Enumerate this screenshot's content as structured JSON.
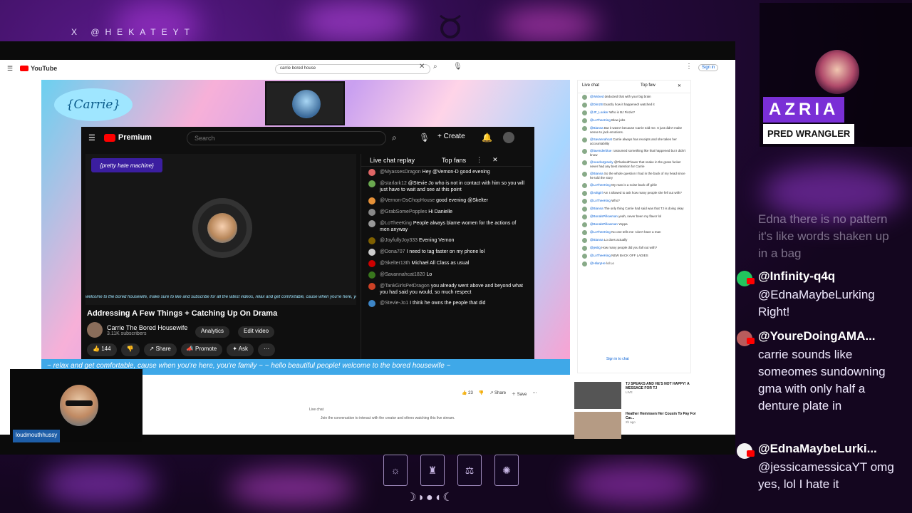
{
  "overlay": {
    "handle": "X @HEKATEYT",
    "streamer_name": "AZRIA",
    "streamer_role": "PRED WRANGLER",
    "webcam_label": "loudmouthhussy",
    "moon_phases": "☽◗●◖☾"
  },
  "browser": {
    "logo": "YouTube",
    "search_value": "carrie bored house",
    "signin": "Sign in"
  },
  "video": {
    "brand_logo": "{Carrie}",
    "banner_text": "{pretty hate machine}",
    "inner_logo": "Premium",
    "inner_search_placeholder": "Search",
    "inner_create": "+ Create",
    "ticker_inner": "welcome to the bored housewife, make sure to like and subscribe for all the latest videos, relax and get comfortable, cause when you're here, you're family",
    "title": "Addressing A Few Things + Catching Up On Drama",
    "channel": "Carrie The Bored Housewife",
    "subs": "3.11K subscribers",
    "analytics": "Analytics",
    "edit_video": "Edit video",
    "likes": "144",
    "share": "Share",
    "promote": "Promote",
    "ask": "Ask",
    "ticker": "~ relax and get comfortable, cause when you're here, you're family ~    ~ hello beautiful people! welcome to the bored housewife ~",
    "live_chat_header": "Live chat replay",
    "top_fans": "Top fans",
    "chat": [
      {
        "user": "@MyassesDragon",
        "text": "Hey @Vernon-D good evening",
        "color": "#e06666"
      },
      {
        "user": "@starlark12",
        "text": "@Stevie Jo who is not in contact with him so you will just have to wait and see at this point",
        "color": "#6aa84f"
      },
      {
        "user": "@Vernon-DsChopHouse",
        "text": "good evening @Skelter",
        "color": "#e69138"
      },
      {
        "user": "@GrabSomePopples",
        "text": "Hi Danielle",
        "color": "#888888"
      },
      {
        "user": "@LoTheeKing",
        "text": "People always blame women for the actions of men anyway",
        "color": "#999999"
      },
      {
        "user": "@JoyfullyJoy333",
        "text": "Evening Vernon",
        "color": "#7f6000"
      },
      {
        "user": "@Dona707",
        "text": "I need to tag faster on my phone lol",
        "color": "#cccccc"
      },
      {
        "user": "@Skelter13th",
        "text": "Michael All Class as usual",
        "color": "#cc0000"
      },
      {
        "user": "@Savannahcat1820",
        "text": "Lo",
        "color": "#38761d"
      },
      {
        "user": "@TankGirlsPetDragon",
        "text": "you already went above and beyond what you had said you would, so much respect",
        "color": "#cc4125"
      },
      {
        "user": "@Stevie-Jo1",
        "text": "I think he owns the people that did",
        "color": "#3d85c6"
      }
    ]
  },
  "page_chat": {
    "header": "Live chat",
    "top_few": "Top few",
    "signin": "Sign in to chat",
    "messages": [
      {
        "user": "@Wicked",
        "text": "deducted that with your big brain"
      },
      {
        "user": "@DimzB",
        "text": "Exactly how it happened! watched it"
      },
      {
        "user": "@JF_Looker",
        "text": "Who is BJ Finzie?"
      },
      {
        "user": "@LoTheeKing",
        "text": "Blow jobs"
      },
      {
        "user": "@Bianna",
        "text": "But it wasn't because Carrie told me. It just didn't make sense to jack emotions."
      },
      {
        "user": "@Savannahcat",
        "text": "Carrie always has receipts and she takes her accountability"
      },
      {
        "user": "@lavenderblue",
        "text": "I assumed something like that happened but I didn't know"
      },
      {
        "user": "@needs4gravity",
        "text": "@FlaskedFlower that snake in the grass fucker never had any best intention for Carrie"
      },
      {
        "user": "@Bianna",
        "text": "So the whole question I had in the back of my head since he told the story"
      },
      {
        "user": "@LoTheeKing",
        "text": "My man is a noise back off girlie"
      },
      {
        "user": "@voltgirl",
        "text": "Am I allowed to ask how many people she fell out with?"
      },
      {
        "user": "@LoTheeKing",
        "text": "Who?"
      },
      {
        "user": "@Bianna",
        "text": "The only thing Carrie had said was that TJ is doing okay"
      },
      {
        "user": "@BonalsPillowman",
        "text": "yeah, never been my flavor lol"
      },
      {
        "user": "@BonalsPillowman",
        "text": "Yeppa"
      },
      {
        "user": "@LoTheeKing",
        "text": "No one tells me I don't have a man"
      },
      {
        "user": "@Bianna",
        "text": "Lo does actually"
      },
      {
        "user": "@jeslig",
        "text": "How many people did you fall out with?"
      },
      {
        "user": "@LoTheeKing",
        "text": "NEW BACK OFF LADIES"
      },
      {
        "user": "@HilaryHe",
        "text": "lol Lo"
      }
    ],
    "below": {
      "likes": "23",
      "share": "Share",
      "save": "Save",
      "live_chat": "Live chat",
      "join": "Join the conversation to interact with the creator and others watching this live stream."
    },
    "recs": [
      {
        "title": "TJ SPEAKS AND HE'S NOT HAPPY! A MESSAGE FOR TJ",
        "sub": "LIVE"
      },
      {
        "title": "Heather Hemmsen Her Cousin To Pay For Car...",
        "sub": "2h ago"
      }
    ]
  },
  "stream_chat": {
    "faded": "Edna there is no pattern it's like words shaken up in a bag",
    "messages": [
      {
        "user": "@Infinity-q4q",
        "text": "@EdnaMaybeLurking Right!",
        "avatar": "#22c55e"
      },
      {
        "user": "@YoureDoingAMA...",
        "text": "carrie sounds like someomes sundowning gma with only half a denture plate in",
        "avatar": "#b85c5c"
      },
      {
        "user": "@EdnaMaybeLurki...",
        "text": "@jessicamessicaYT omg yes, lol I hate it",
        "avatar": "#f3f3f3"
      }
    ]
  }
}
